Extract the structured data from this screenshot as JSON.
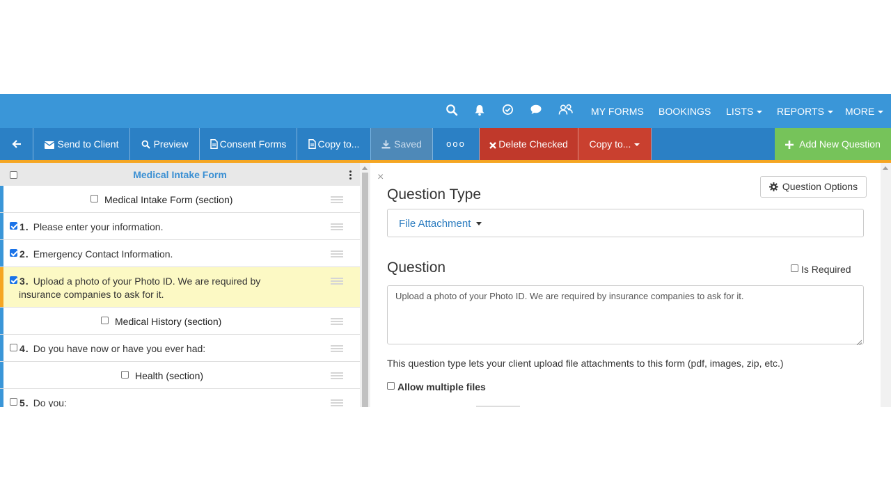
{
  "nav": {
    "my_forms": "MY FORMS",
    "bookings": "BOOKINGS",
    "lists": "LISTS",
    "reports": "REPORTS",
    "more": "MORE"
  },
  "toolbar": {
    "send_to_client": "Send to Client",
    "preview": "Preview",
    "consent_forms": "Consent Forms",
    "copy_to": "Copy to...",
    "saved": "Saved",
    "more_dots": "ooo",
    "delete_checked": "Delete Checked",
    "copy_to_dropdown": "Copy to...",
    "add_new_question": "Add New Question"
  },
  "left_panel": {
    "title": "Medical Intake Form",
    "items": [
      {
        "type": "section",
        "label": "Medical Intake Form (section)"
      },
      {
        "type": "question",
        "num": "1.",
        "label": "Please enter your information.",
        "checked": true
      },
      {
        "type": "question",
        "num": "2.",
        "label": "Emergency Contact Information.",
        "checked": true
      },
      {
        "type": "question",
        "num": "3.",
        "label_line1": "Upload a photo of your Photo ID. We are required by",
        "label_line2": "insurance companies to ask for it.",
        "checked": true
      },
      {
        "type": "section",
        "label": "Medical History (section)"
      },
      {
        "type": "question",
        "num": "4.",
        "label": "Do you have now or have you ever had:",
        "checked": false
      },
      {
        "type": "section",
        "label": "Health (section)"
      },
      {
        "type": "question",
        "num": "5.",
        "label": "Do you:",
        "checked": false
      }
    ]
  },
  "editor": {
    "close": "×",
    "question_type_heading": "Question Type",
    "question_options": "Question Options",
    "question_type_value": "File Attachment",
    "question_heading": "Question",
    "is_required": "Is Required",
    "question_text": "Upload a photo of your Photo ID. We are required by insurance companies to ask for it.",
    "help_text": "This question type lets your client upload file attachments to this form (pdf, images, zip, etc.)",
    "allow_multiple": "Allow multiple files"
  },
  "colors": {
    "nav_bg": "#3a96d8",
    "toolbar_bg": "#2b80c5",
    "danger": "#c0392b",
    "add_green": "#76c35a",
    "accent_orange": "#f5a623",
    "highlight_row": "#fcf9c4"
  }
}
